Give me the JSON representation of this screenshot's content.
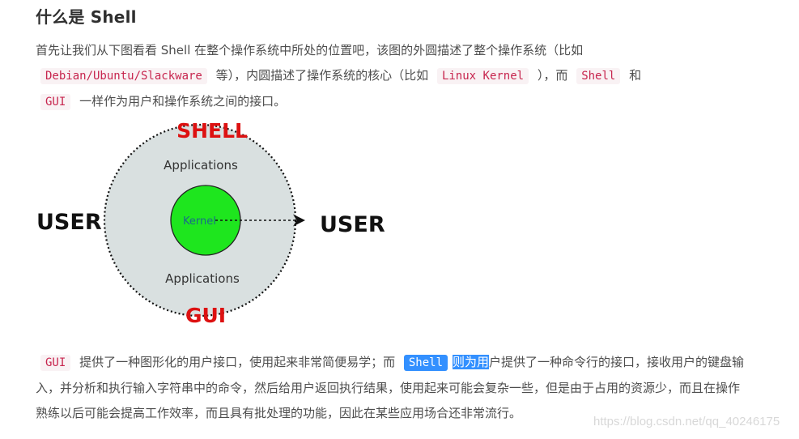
{
  "heading": "什么是 Shell",
  "para1": {
    "t1": "首先让我们从下图看看 Shell 在整个操作系统中所处的位置吧，该图的外圆描述了整个操作系统（比如",
    "code1": "Debian/Ubuntu/Slackware",
    "t2": "等），内圆描述了操作系统的核心（比如",
    "code2": "Linux Kernel",
    "t3": "），而",
    "code3": "Shell",
    "t4": "和",
    "code4": "GUI",
    "t5": "一样作为用户和操作系统之间的接口。"
  },
  "diagram": {
    "shell_label": "SHELL",
    "gui_label": "GUI",
    "apps_top": "Applications",
    "apps_bottom": "Applications",
    "kernel_label": "Kernel",
    "user_left": "USER",
    "user_right": "USER",
    "colors": {
      "outer_fill": "#d9e0e0",
      "kernel_fill": "#1ee61e",
      "label_red": "#dd1111",
      "kernel_text": "#1a6b8a"
    }
  },
  "para2": {
    "code1": "GUI",
    "t1": "提供了一种图形化的用户接口，使用起来非常简便易学；而",
    "code2": "Shell",
    "sel_text": "则为用",
    "t2": "户提供了一种命令行的接口，接收用户的键盘输入，并分析和执行输入字符串中的命令，然后给用户返回执行结果，使用起来可能会复杂一些，但是由于占用的资源少，而且在操作熟练以后可能会提高工作效率，而且具有批处理的功能，因此在某些应用场合还非常流行。"
  },
  "watermark": "https://blog.csdn.net/qq_40246175"
}
